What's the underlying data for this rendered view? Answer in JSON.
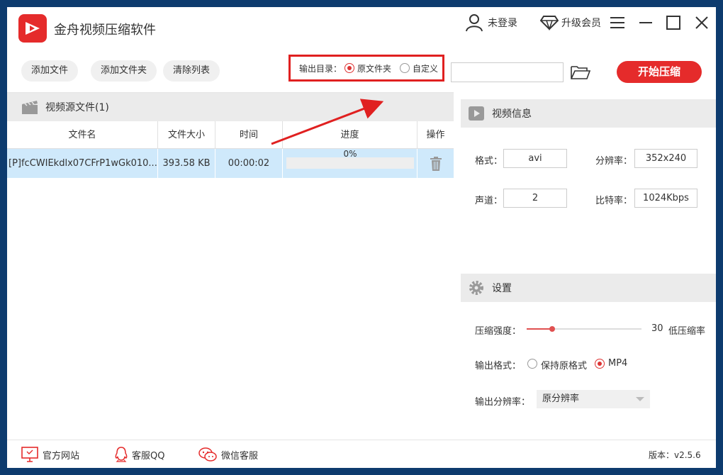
{
  "app": {
    "title": "金舟视频压缩软件"
  },
  "titlebar": {
    "login_label": "未登录",
    "vip_label": "升级会员"
  },
  "toolbar": {
    "add_file": "添加文件",
    "add_folder": "添加文件夹",
    "clear_list": "清除列表",
    "output_dir_label": "输出目录：",
    "output_option_source": "原文件夹",
    "output_option_custom": "自定义",
    "output_selected": "原文件夹",
    "output_path_value": "",
    "start_button": "开始压缩"
  },
  "file_panel": {
    "title": "视频源文件(1)",
    "columns": [
      "文件名",
      "文件大小",
      "时间",
      "进度",
      "操作"
    ],
    "rows": [
      {
        "name": "[P]fcCWIEkdlx07CFrP1wGk010...",
        "size": "393.58 KB",
        "duration": "00:00:02",
        "progress_text": "0%",
        "progress_fraction": 0
      }
    ]
  },
  "video_info": {
    "title": "视频信息",
    "format_label": "格式：",
    "format_value": "avi",
    "resolution_label": "分辨率：",
    "resolution_value": "352x240",
    "channel_label": "声道：",
    "channel_value": "2",
    "bitrate_label": "比特率：",
    "bitrate_value": "1024Kbps"
  },
  "settings": {
    "title": "设置",
    "strength_label": "压缩强度：",
    "strength_value": "30",
    "strength_fraction": 0.22,
    "strength_desc": "低压缩率",
    "format_label": "输出格式：",
    "format_keep": "保持原格式",
    "format_mp4": "MP4",
    "format_selected": "MP4",
    "resolution_label": "输出分辨率：",
    "resolution_selected": "原分辨率"
  },
  "footer": {
    "website": "官方网站",
    "qq": "客服QQ",
    "wechat": "微信客服",
    "version": "版本：v2.5.6"
  },
  "colors": {
    "brand": "#e52b2b",
    "highlight_row": "#cfe9fb",
    "panel_header": "#ebebeb"
  }
}
